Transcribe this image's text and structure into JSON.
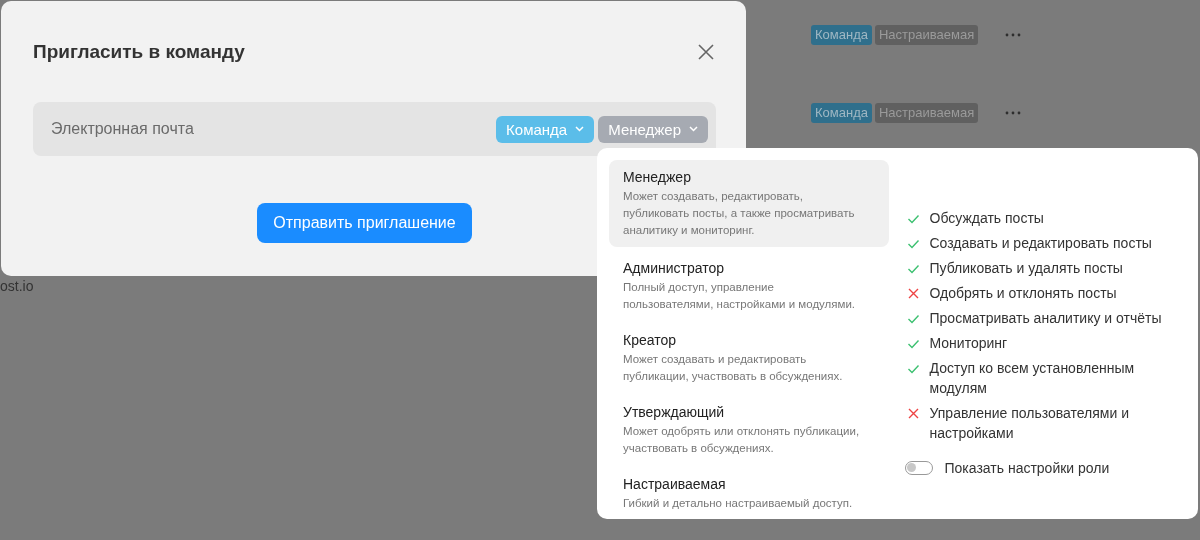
{
  "background": {
    "rows": [
      {
        "tags": [
          {
            "label": "Команда",
            "kind": "team"
          },
          {
            "label": "Настраиваемая",
            "kind": "role"
          }
        ]
      },
      {
        "tags": [
          {
            "label": "Команда",
            "kind": "team"
          },
          {
            "label": "Настраиваемая",
            "kind": "role"
          }
        ]
      }
    ],
    "footer_text": "ost.io"
  },
  "dialog": {
    "title": "Пригласить в команду",
    "email": {
      "placeholder": "Электронная почта"
    },
    "team_select": {
      "label": "Команда"
    },
    "role_select": {
      "label": "Менеджер",
      "expanded": true
    },
    "send_button": "Отправить приглашение"
  },
  "role_menu": {
    "roles": [
      {
        "name": "Менеджер",
        "description": "Может создавать, редактировать, публиковать посты, а также просматривать аналитику и мониторинг.",
        "selected": true
      },
      {
        "name": "Администратор",
        "description": "Полный доступ, управление пользователями, настройками и модулями.",
        "selected": false
      },
      {
        "name": "Креатор",
        "description": "Может создавать и редактировать публикации, участвовать в обсуждениях.",
        "selected": false
      },
      {
        "name": "Утверждающий",
        "description": "Может одобрять или отклонять публикации, участвовать в обсуждениях.",
        "selected": false
      },
      {
        "name": "Настраиваемая",
        "description": "Гибкий и детально настраиваемый доступ.",
        "selected": false
      }
    ],
    "permissions": [
      {
        "label": "Обсуждать посты",
        "allowed": true
      },
      {
        "label": "Создавать и редактировать посты",
        "allowed": true
      },
      {
        "label": "Публиковать и удалять посты",
        "allowed": true
      },
      {
        "label": "Одобрять и отклонять посты",
        "allowed": false
      },
      {
        "label": "Просматривать аналитику и отчёты",
        "allowed": true
      },
      {
        "label": "Мониторинг",
        "allowed": true
      },
      {
        "label": "Доступ ко всем установленным модулям",
        "allowed": true
      },
      {
        "label": "Управление пользователями и настройками",
        "allowed": false
      }
    ],
    "toggle": {
      "label": "Показать настройки роли",
      "on": false
    }
  }
}
